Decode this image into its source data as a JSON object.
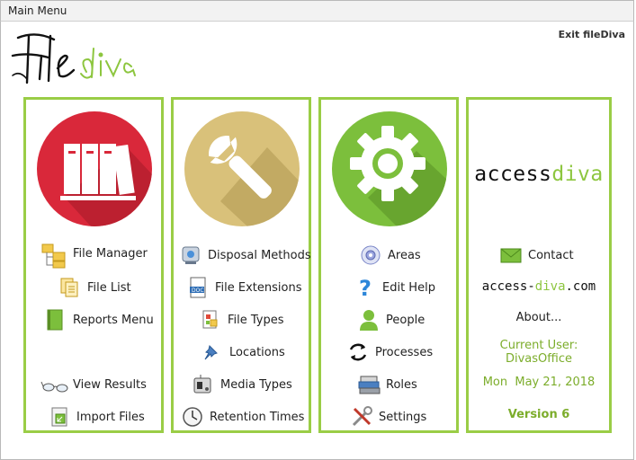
{
  "window": {
    "title": "Main Menu"
  },
  "header": {
    "exit_label": "Exit fileDiva",
    "logo_text_dark": "File",
    "logo_text_green": "diva"
  },
  "panels": {
    "files": {
      "items": [
        "File Manager",
        "File List",
        "Reports Menu",
        "View Results",
        "Import Files"
      ]
    },
    "settings": {
      "items": [
        "Disposal Methods",
        "File Extensions",
        "File Types",
        "Locations",
        "Media Types",
        "Retention Times"
      ]
    },
    "admin": {
      "items": [
        "Areas",
        "Edit Help",
        "People",
        "Processes",
        "Roles",
        "Settings"
      ]
    },
    "info": {
      "brand_dark": "access",
      "brand_green": "diva",
      "contact": "Contact",
      "site_dark": "access-",
      "site_green": "diva",
      "site_end": ".com",
      "about": "About...",
      "current_user_label": "Current User:",
      "current_user": "DivasOffice",
      "date": "Mon  May 21, 2018",
      "version": "Version 6"
    }
  },
  "colors": {
    "accent": "#9acd46",
    "red": "#d9283a",
    "gold": "#d9c17a",
    "green": "#7cbf3c"
  }
}
